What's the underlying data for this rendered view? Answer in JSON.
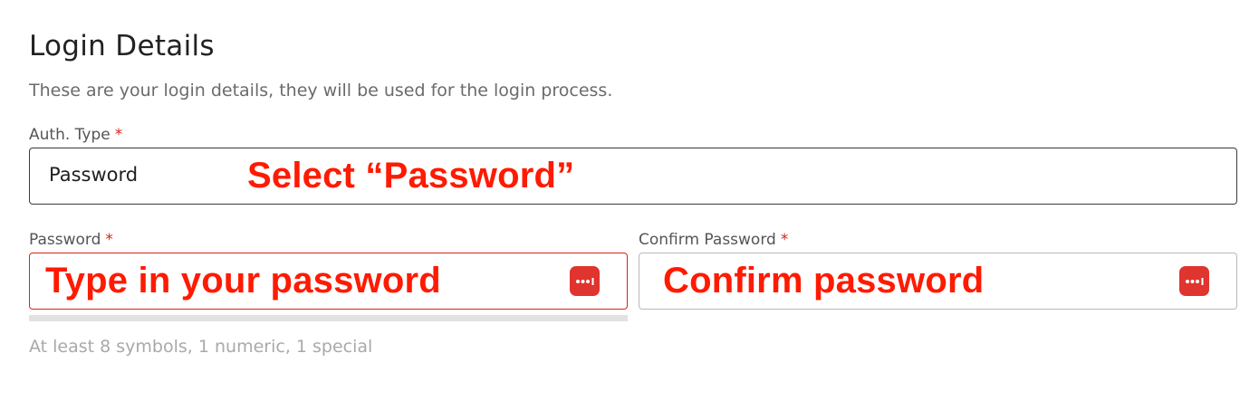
{
  "section": {
    "title": "Login Details",
    "subtitle": "These are your login details, they will be used for the login process."
  },
  "auth_type": {
    "label": "Auth. Type",
    "required_mark": "*",
    "value": "Password",
    "annotation": "Select “Password”"
  },
  "password": {
    "label": "Password",
    "required_mark": "*",
    "annotation": "Type in your password",
    "icon": "password-manager-icon",
    "hint": "At least 8 symbols, 1 numeric, 1 special"
  },
  "confirm_password": {
    "label": "Confirm Password",
    "required_mark": "*",
    "annotation": "Confirm password",
    "icon": "password-manager-icon"
  },
  "colors": {
    "required": "#d8231b",
    "error_border": "#d8231b",
    "annotation": "#ff1a00",
    "icon_bg": "#e0342e",
    "strength_track": "#e2e2e2"
  }
}
